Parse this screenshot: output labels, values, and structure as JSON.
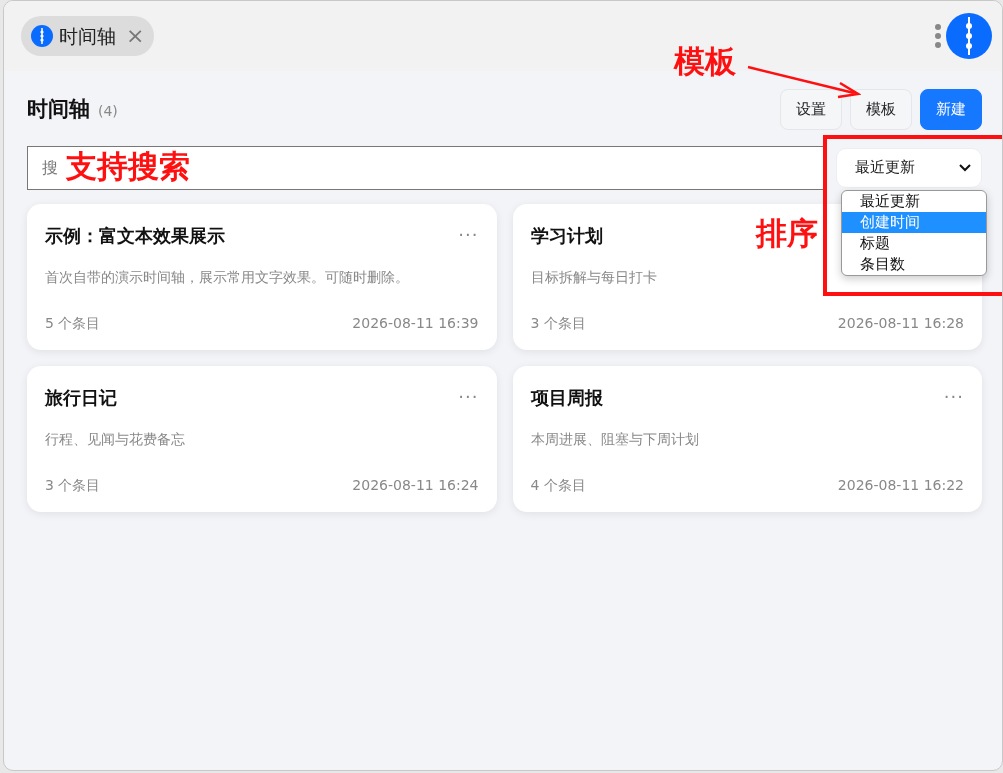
{
  "tab": {
    "label": "时间轴",
    "close": "×"
  },
  "header": {
    "title": "时间轴",
    "count": "(4)",
    "buttons": [
      {
        "label": "设置",
        "kind": "light"
      },
      {
        "label": "模板",
        "kind": "light"
      },
      {
        "label": "新建",
        "kind": "primary"
      }
    ]
  },
  "search": {
    "placeholder": "搜"
  },
  "sort": {
    "value": "最近更新",
    "expanded": true,
    "options": [
      {
        "label": "最近更新",
        "highlighted": false
      },
      {
        "label": "创建时间",
        "highlighted": true
      },
      {
        "label": "标题",
        "highlighted": false
      },
      {
        "label": "条目数",
        "highlighted": false
      }
    ]
  },
  "cards": [
    {
      "title": "示例：富文本效果展示",
      "menu": "···",
      "description": "首次自带的演示时间轴，展示常用文字效果。可随时删除。",
      "count": "5 个条目",
      "updated": "2026-08-11 16:39"
    },
    {
      "title": "学习计划",
      "description": "目标拆解与每日打卡",
      "count": "3 个条目",
      "updated": "2026-08-11 16:28"
    },
    {
      "title": "旅行日记",
      "menu": "···",
      "description": "行程、见闻与花费备忘",
      "count": "3 个条目",
      "updated": "2026-08-11 16:24"
    },
    {
      "title": "项目周报",
      "menu": "···",
      "description": "本周进展、阻塞与下周计划",
      "count": "4 个条目",
      "updated": "2026-08-11 16:22"
    }
  ],
  "annotations": [
    {
      "kind": "template",
      "text": "模板"
    },
    {
      "kind": "search",
      "text": "支持搜索"
    },
    {
      "kind": "sort",
      "text": "排序"
    }
  ]
}
